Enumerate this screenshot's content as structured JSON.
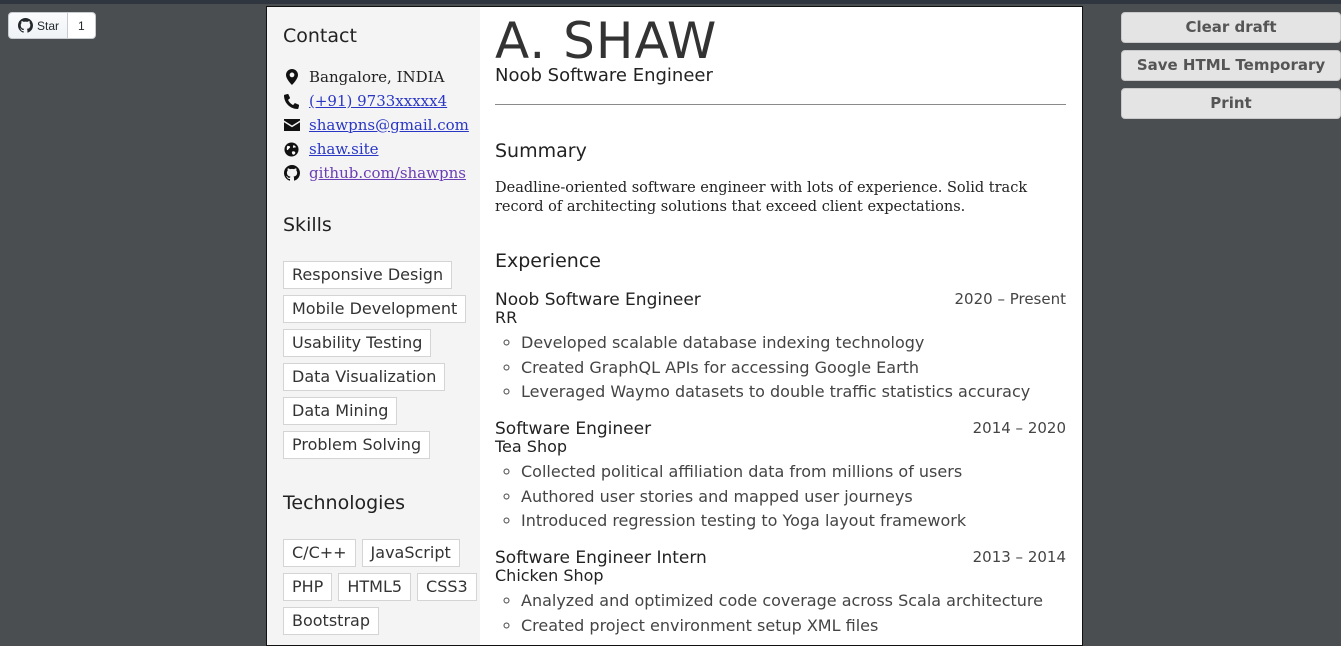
{
  "github": {
    "label": "Star",
    "count": "1"
  },
  "actions": [
    "Clear draft",
    "Save HTML Temporary",
    "Print"
  ],
  "contact": {
    "heading": "Contact",
    "location": "Bangalore, INDIA",
    "phone": "(+91) 9733xxxxx4",
    "email": "shawpns@gmail.com",
    "website": "shaw.site",
    "github": "github.com/shawpns"
  },
  "skills": {
    "heading": "Skills",
    "items": [
      "Responsive Design",
      "Mobile Development",
      "Usability Testing",
      "Data Visualization",
      "Data Mining",
      "Problem Solving"
    ]
  },
  "technologies": {
    "heading": "Technologies",
    "items": [
      "C/C++",
      "JavaScript",
      "PHP",
      "HTML5",
      "CSS3",
      "Bootstrap"
    ]
  },
  "header": {
    "name": "A. SHAW",
    "title": "Noob Software Engineer"
  },
  "summary": {
    "heading": "Summary",
    "text": "Deadline-oriented software engineer with lots of experience. Solid track record of architecting solutions that exceed client expectations."
  },
  "experience": {
    "heading": "Experience",
    "jobs": [
      {
        "title": "Noob Software Engineer",
        "company": "RR",
        "dates": "2020 – Present",
        "bullets": [
          "Developed scalable database indexing technology",
          "Created GraphQL APIs for accessing Google Earth",
          "Leveraged Waymo datasets to double traffic statistics accuracy"
        ]
      },
      {
        "title": "Software Engineer",
        "company": "Tea Shop",
        "dates": "2014 – 2020",
        "bullets": [
          "Collected political affiliation data from millions of users",
          "Authored user stories and mapped user journeys",
          "Introduced regression testing to Yoga layout framework"
        ]
      },
      {
        "title": "Software Engineer Intern",
        "company": "Chicken Shop",
        "dates": "2013 – 2014",
        "bullets": [
          "Analyzed and optimized code coverage across Scala architecture",
          "Created project environment setup XML files"
        ]
      }
    ]
  },
  "colors": {
    "background": "#4b4e51",
    "sidebar": "#f4f4f4",
    "link": "#2a37c4"
  }
}
